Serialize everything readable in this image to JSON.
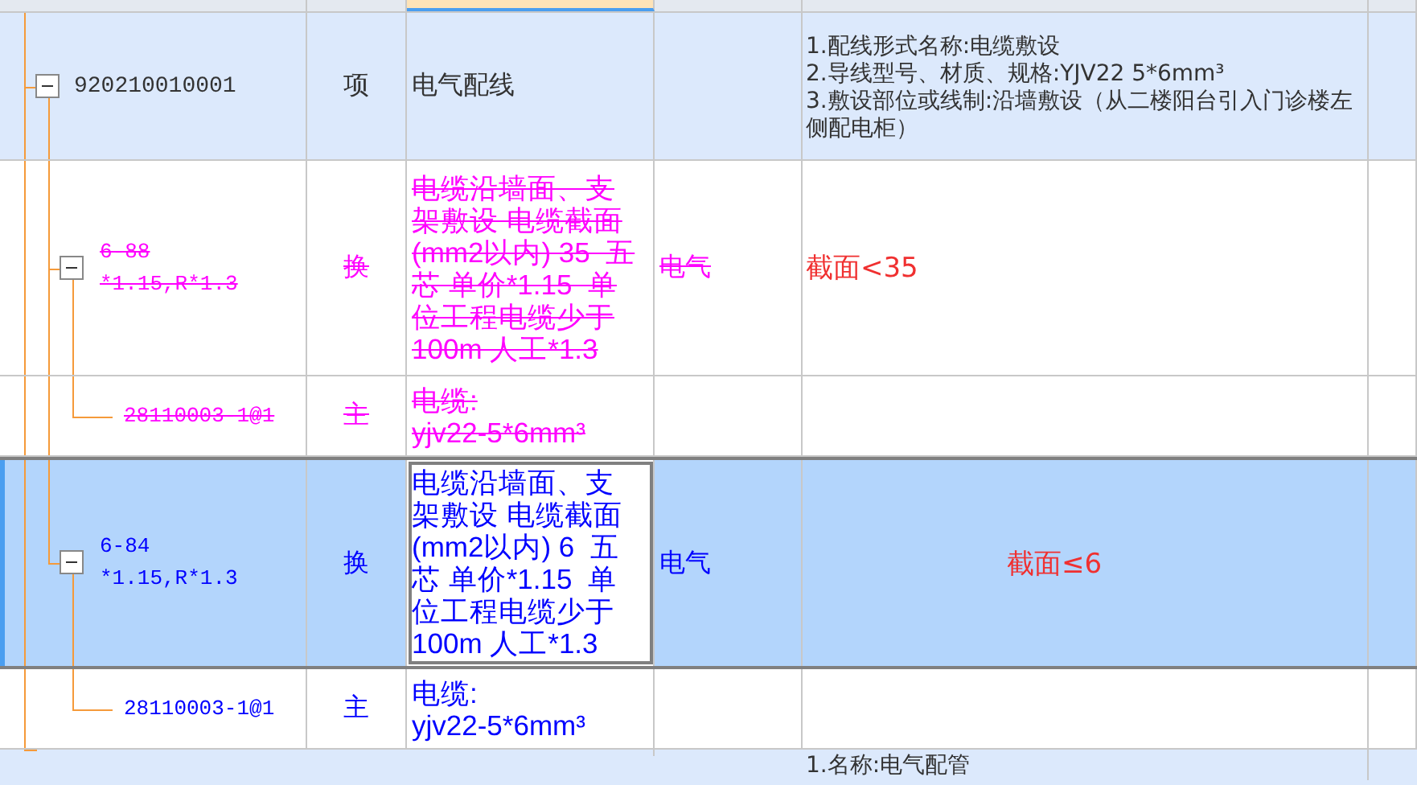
{
  "rows": [
    {
      "kind": "item",
      "code": "920210010001",
      "unit": "项",
      "name": "电气配线",
      "features": "1.配线形式名称:电缆敷设\n2.导线型号、材质、规格:YJV22 5*6mm³\n3.敷设部位或线制:沿墙敷设（从二楼阳台引入门诊楼左侧配电柜）",
      "selected": false,
      "expanded": true,
      "children": [
        {
          "kind": "sub",
          "code": "6-88",
          "code_2": "*1.15,R*1.3",
          "unit": "换",
          "name": "电缆沿墙面、支架敷设 电缆截面(mm2以内) 35  五芯 单价*1.15  单位工程电缆少于100m 人工*1.3",
          "category": "电气",
          "note": "截面<35",
          "deleted": true,
          "selected": false,
          "expanded": true,
          "children": [
            {
              "kind": "material",
              "code": "28110003-1@1",
              "unit": "主",
              "name": "电缆:\nyjv22-5*6mm³",
              "deleted": true,
              "selected": false
            }
          ]
        },
        {
          "kind": "sub",
          "code": "6-84",
          "code_2": "*1.15,R*1.3",
          "unit": "换",
          "name": "电缆沿墙面、支架敷设 电缆截面(mm2以内) 6  五芯 单价*1.15  单位工程电缆少于100m 人工*1.3",
          "category": "电气",
          "note": "截面≤6",
          "deleted": false,
          "selected": true,
          "expanded": true,
          "children": [
            {
              "kind": "material",
              "code": "28110003-1@1",
              "unit": "主",
              "name": "电缆:\nyjv22-5*6mm³",
              "deleted": false,
              "selected": false
            }
          ]
        }
      ]
    },
    {
      "kind": "item",
      "features": "1.名称:电气配管",
      "selected": false
    }
  ]
}
